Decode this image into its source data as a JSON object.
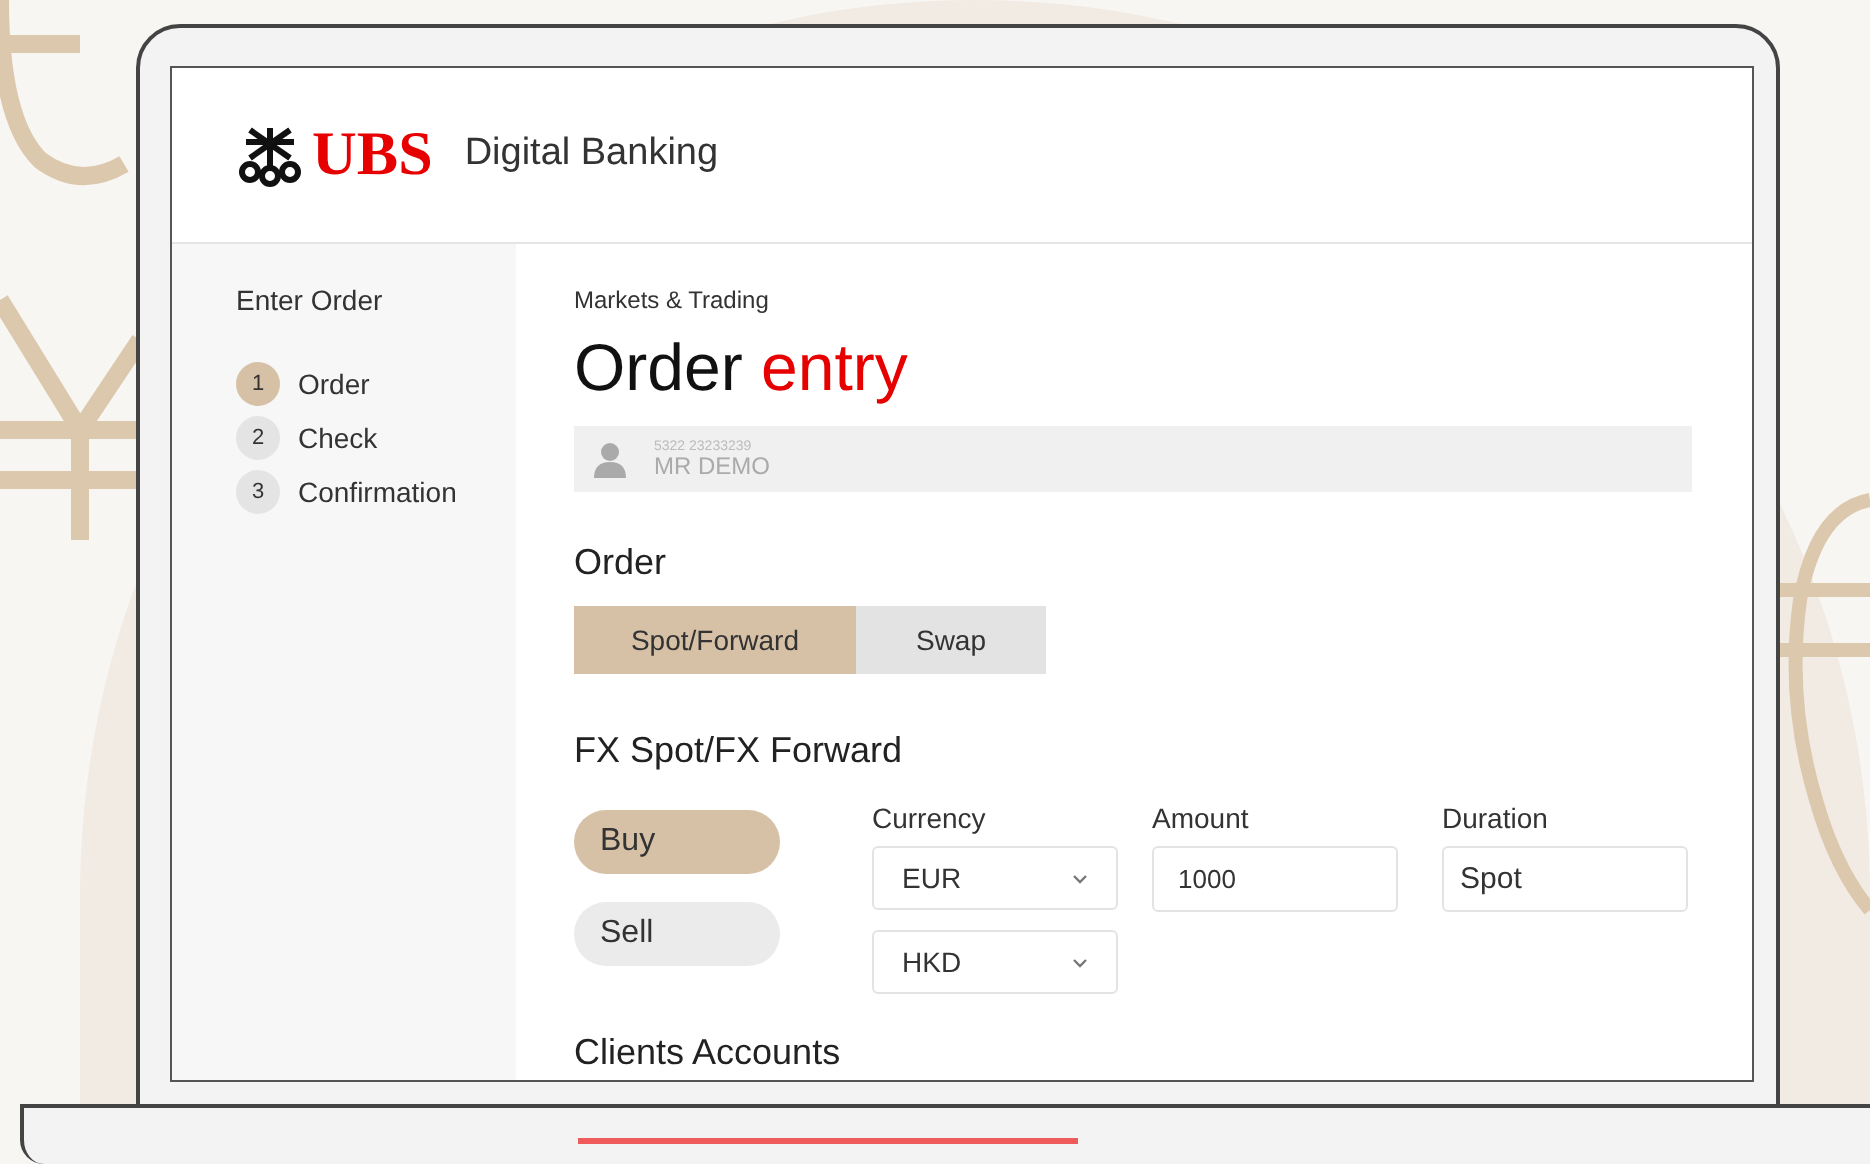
{
  "header": {
    "brand": "UBS",
    "title": "Digital Banking"
  },
  "sidebar": {
    "title": "Enter Order",
    "steps": [
      {
        "number": "1",
        "label": "Order",
        "selected": true
      },
      {
        "number": "2",
        "label": "Check",
        "selected": false
      },
      {
        "number": "3",
        "label": "Confirmation",
        "selected": false
      }
    ]
  },
  "breadcrumb": "Markets & Trading",
  "heading": {
    "text": "Order",
    "highlight": "entry"
  },
  "client": {
    "account": "5322 23233239",
    "name": "MR DEMO"
  },
  "order": {
    "title": "Order",
    "tabs": [
      {
        "label": "Spot/Forward",
        "selected": true
      },
      {
        "label": "Swap",
        "selected": false
      }
    ]
  },
  "fx": {
    "title": "FX Spot/FX Forward",
    "sides": [
      {
        "label": "Buy",
        "selected": true
      },
      {
        "label": "Sell",
        "selected": false
      }
    ],
    "currency": {
      "label": "Currency",
      "selects": [
        "EUR",
        "HKD"
      ]
    },
    "amount": {
      "label": "Amount",
      "value": "1000"
    },
    "duration": {
      "label": "Duration",
      "value": "Spot"
    }
  },
  "next_section": "Clients Accounts"
}
